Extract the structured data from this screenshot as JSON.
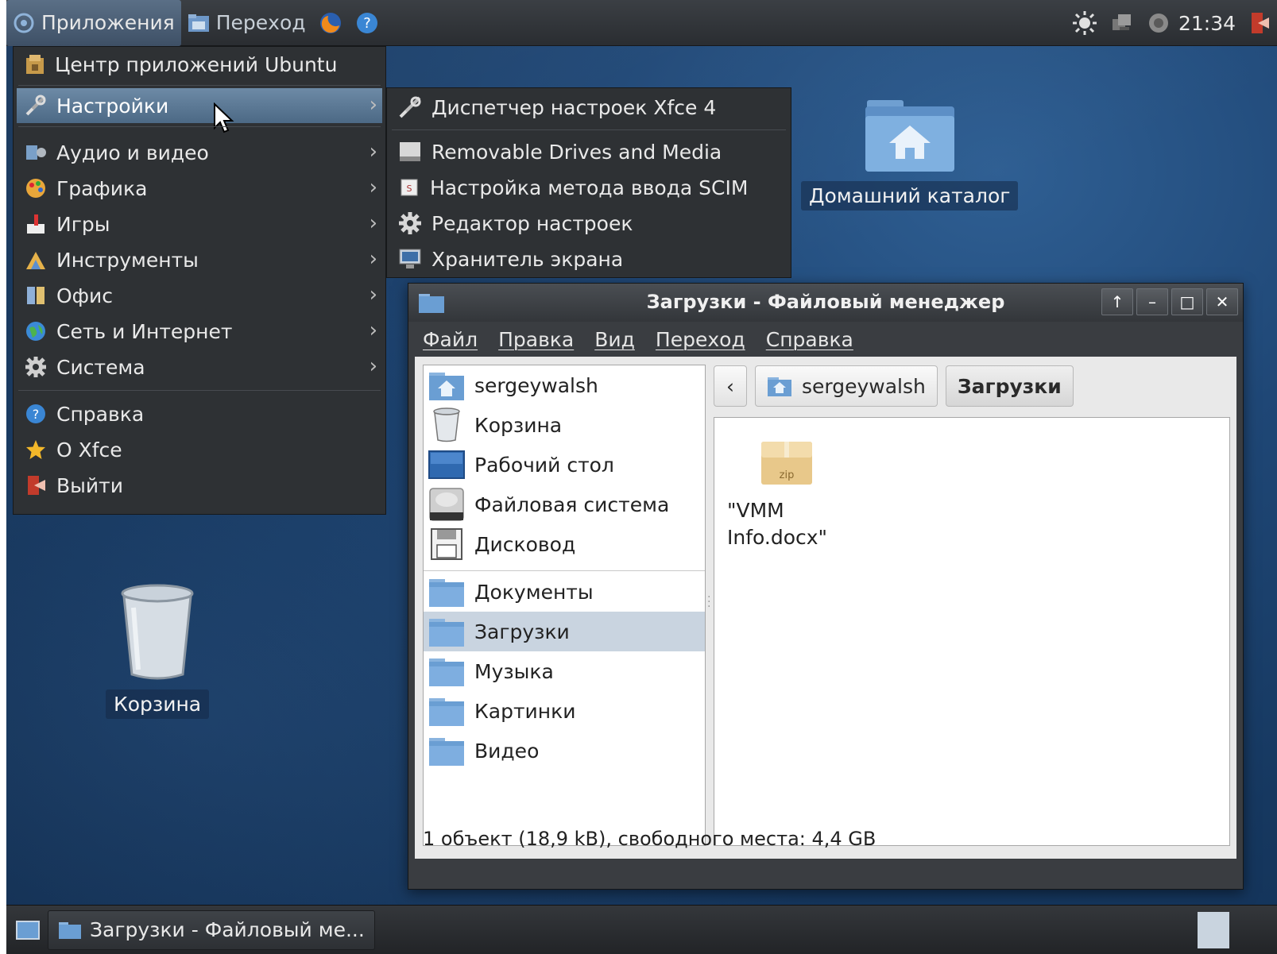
{
  "top_panel": {
    "apps_label": "Приложения",
    "places_label": "Переход",
    "clock": "21:34"
  },
  "app_menu": {
    "items": [
      {
        "label": "Центр приложений Ubuntu",
        "icon": "software-center-icon"
      },
      {
        "label": "Настройки",
        "icon": "settings-tools-icon",
        "submenu": true,
        "highlighted": true
      },
      {
        "label": "Аудио и видео",
        "icon": "multimedia-icon",
        "submenu": true
      },
      {
        "label": "Графика",
        "icon": "graphics-icon",
        "submenu": true
      },
      {
        "label": "Игры",
        "icon": "games-icon",
        "submenu": true
      },
      {
        "label": "Инструменты",
        "icon": "accessories-icon",
        "submenu": true
      },
      {
        "label": "Офис",
        "icon": "office-icon",
        "submenu": true
      },
      {
        "label": "Сеть и Интернет",
        "icon": "internet-icon",
        "submenu": true
      },
      {
        "label": "Система",
        "icon": "system-gear-icon",
        "submenu": true
      },
      {
        "label": "Справка",
        "icon": "help-icon"
      },
      {
        "label": "О Xfce",
        "icon": "about-star-icon"
      },
      {
        "label": "Выйти",
        "icon": "logout-icon"
      }
    ]
  },
  "settings_submenu": {
    "items": [
      {
        "label": "Диспетчер настроек Xfce 4",
        "icon": "settings-manager-icon"
      },
      {
        "label": "Removable Drives and Media",
        "icon": "removable-drive-icon"
      },
      {
        "label": "Настройка метода ввода SCIM",
        "icon": "input-method-icon"
      },
      {
        "label": "Редактор настроек",
        "icon": "settings-editor-icon"
      },
      {
        "label": "Хранитель экрана",
        "icon": "screensaver-icon"
      }
    ]
  },
  "desktop": {
    "home_label": "Домашний каталог",
    "trash_label": "Корзина"
  },
  "file_manager": {
    "title": "Загрузки - Файловый менеджер",
    "menu": [
      "Файл",
      "Правка",
      "Вид",
      "Переход",
      "Справка"
    ],
    "sidebar": {
      "devices": [
        {
          "label": "sergeywalsh",
          "icon": "home-folder-icon"
        },
        {
          "label": "Корзина",
          "icon": "trash-icon"
        },
        {
          "label": "Рабочий стол",
          "icon": "desktop-folder-icon"
        },
        {
          "label": "Файловая система",
          "icon": "harddisk-icon"
        },
        {
          "label": "Дисковод",
          "icon": "floppy-icon"
        }
      ],
      "places": [
        {
          "label": "Документы",
          "icon": "folder-icon"
        },
        {
          "label": "Загрузки",
          "icon": "folder-icon",
          "selected": true
        },
        {
          "label": "Музыка",
          "icon": "folder-icon"
        },
        {
          "label": "Картинки",
          "icon": "folder-icon"
        },
        {
          "label": "Видео",
          "icon": "folder-icon"
        }
      ]
    },
    "path": {
      "parent": "sergeywalsh",
      "current": "Загрузки"
    },
    "files": [
      {
        "name_line1": "\"VMM",
        "name_line2": "Info.docx\"",
        "icon_text": "zip"
      }
    ],
    "status": "1 объект (18,9 kB), свободного места: 4,4 GB"
  },
  "taskbar": {
    "task_label": "Загрузки - Файловый ме..."
  },
  "colors": {
    "menu_bg": "#2e3134",
    "highlight": "#5b7893",
    "desktop": "#1f4776"
  }
}
